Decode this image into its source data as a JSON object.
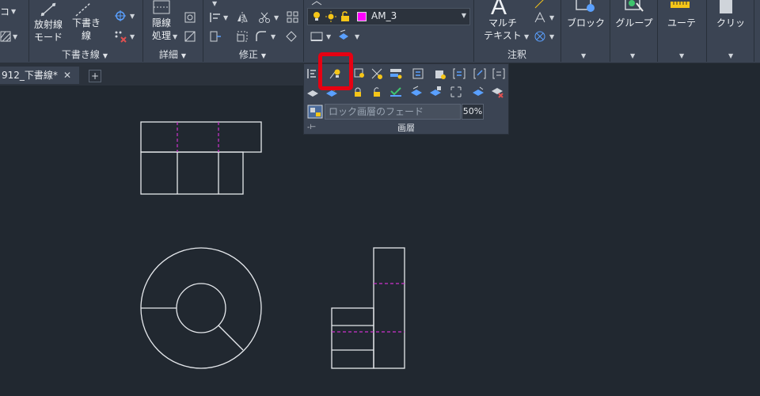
{
  "ribbon": {
    "left_clip_top": "コ",
    "radial_line_label": "放射線",
    "mode_label": "モード",
    "draft_label_line1": "下書き",
    "draft_label_line2": "線",
    "draft_panel": "下書き線",
    "hidden_line_label": "隠線",
    "process_label": "処理",
    "detail_panel": "詳細",
    "modify_panel": "修正",
    "multi_label": "マルチ",
    "text_label": "テキスト",
    "annotation_panel": "注釈",
    "block_label": "ブロック",
    "group_label": "グループ",
    "utility_label": "ユーテ",
    "clipboard_label": "クリッ",
    "current_layer": "AM_3",
    "layer_color": "#ff00ff"
  },
  "layer_flyout": {
    "fade_label": "ロック画層のフェード",
    "fade_percent": "50%",
    "panel_title": "画層"
  },
  "tabs": {
    "document": "912_下書線*",
    "close": "✕",
    "new_tab": "+"
  }
}
